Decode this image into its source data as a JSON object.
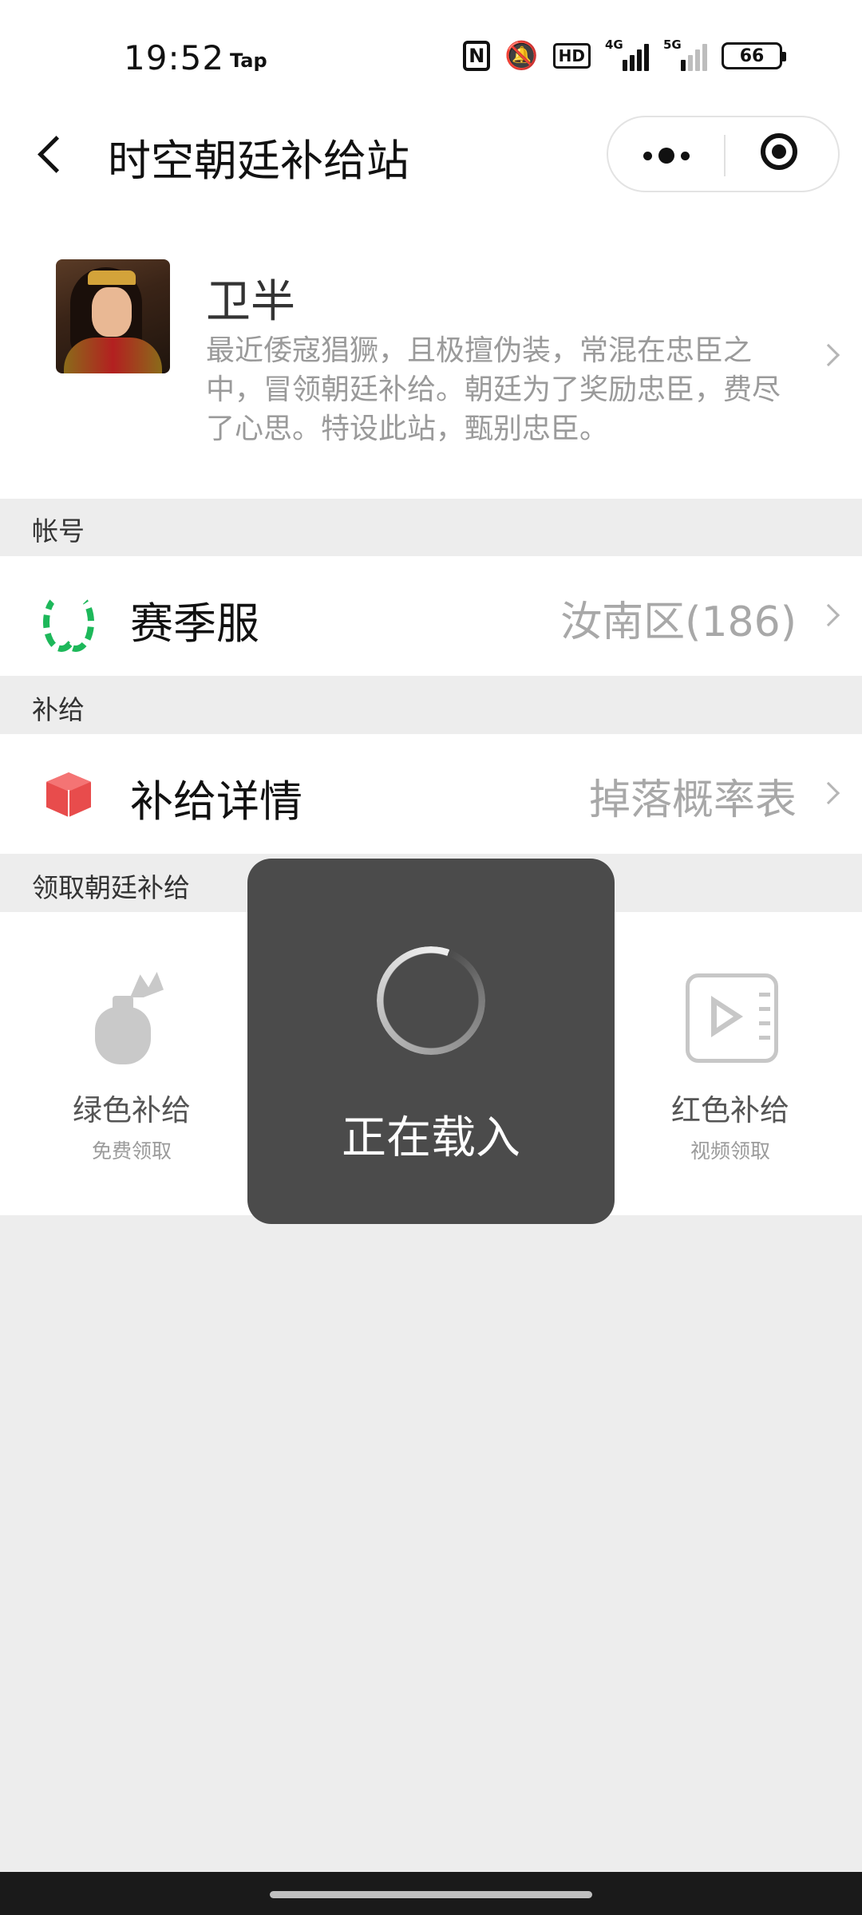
{
  "status_bar": {
    "time": "19:52",
    "tap_label": "Tap",
    "icons": [
      "nfc-icon",
      "bell-off-icon",
      "hd-icon",
      "4g-signal-icon",
      "5g-signal-icon",
      "battery-icon"
    ],
    "hd_label": "HD",
    "signal_4g_label": "4G",
    "signal_5g_label": "5G",
    "battery_level": "66"
  },
  "nav": {
    "title": "时空朝廷补给站",
    "back_icon": "chevron-left-icon",
    "more_icon": "more-dots-icon",
    "close_icon": "target-close-icon"
  },
  "profile": {
    "name": "卫半",
    "description": "最近倭寇猖獗，且极擅伪装，常混在忠臣之中，冒领朝廷补给。朝廷为了奖励忠臣，费尽了心思。特设此站，甄别忠臣。"
  },
  "sections": {
    "account": "帐号",
    "supply": "补给",
    "claim": "领取朝廷补给"
  },
  "rows": {
    "server": {
      "label": "赛季服",
      "value": "汝南区(186)",
      "icon": "laurel-icon"
    },
    "supply_detail": {
      "label": "补给详情",
      "value": "掉落概率表",
      "icon": "gift-box-icon"
    }
  },
  "rewards": [
    {
      "title": "绿色补给",
      "subtitle": "免费领取",
      "icon": "bag-icon"
    },
    {
      "title": "红色补给",
      "subtitle": "视频领取",
      "icon": "video-play-icon"
    }
  ],
  "loading_toast": {
    "text": "正在载入",
    "icon": "spinner-icon"
  },
  "colors": {
    "laurel_green": "#1db85a",
    "box_red": "#e84c4c",
    "toast_bg": "#4b4b4b",
    "page_bg": "#ededed"
  }
}
